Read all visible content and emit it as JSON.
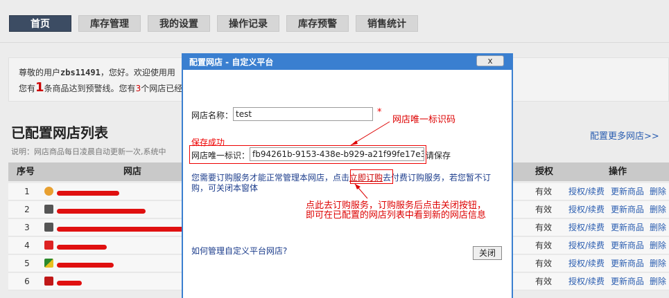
{
  "nav": {
    "tabs": [
      {
        "label": "首页",
        "active": true
      },
      {
        "label": "库存管理"
      },
      {
        "label": "我的设置"
      },
      {
        "label": "操作记录"
      },
      {
        "label": "库存预警"
      },
      {
        "label": "销售统计"
      }
    ]
  },
  "welcome": {
    "line1_prefix": "尊敬的用户",
    "username": "zbs11491",
    "line1_suffix": "，您好。欢迎使用用",
    "line2_prefix": "您有",
    "warn_count": "1",
    "line2_mid": "条商品达到预警线。您有",
    "shop_count": "3",
    "line2_suffix": "个网店已经"
  },
  "list": {
    "title": "已配置网店列表",
    "config_more": "配置更多网店>>",
    "explain": "说明：网店商品每日凌晨自动更新一次,系统中"
  },
  "table": {
    "headers": {
      "index": "序号",
      "shop": "网店",
      "auth": "授权",
      "ops": "操作"
    },
    "rows": [
      {
        "num": "1",
        "status": "有效"
      },
      {
        "num": "2",
        "status": "有效"
      },
      {
        "num": "3",
        "status": "有效"
      },
      {
        "num": "4",
        "status": "有效"
      },
      {
        "num": "5",
        "status": "有效"
      },
      {
        "num": "6",
        "status": "有效"
      }
    ],
    "actions": {
      "auth": "授权/续费",
      "update": "更新商品",
      "delete": "删除"
    }
  },
  "dialog": {
    "title": "配置网店 - 自定义平台",
    "close_x": "x",
    "shop_name_label": "网店名称：",
    "shop_name_value": "test",
    "required_mark": "*",
    "save_success": "保存成功",
    "uid_label": "网店唯一标识：",
    "uid_value": "fb94261b-9153-438e-b929-a21f99fe17e3",
    "save_hint": "请保存",
    "info_prefix": "您需要订购服务才能正常管理本网店，点击",
    "buy_link": "立即订购",
    "info_suffix": "去付费订购服务，若您暂不订购，可关闭本窗体",
    "howto": "如何管理自定义平台网店?",
    "close_button": "关闭"
  },
  "annotations": {
    "uid_note": "网店唯一标识码",
    "buy_note_line1": "点此去订购服务，订购服务后点击关闭按钮，",
    "buy_note_line2": "即可在已配置的网店列表中看到新的网店信息"
  },
  "colors": {
    "nav_active": "#3c4c63",
    "dialog_titlebar": "#3a7fd0",
    "annotation": "#dd0000",
    "link": "#2a5db0",
    "redaction": "#e01010"
  }
}
